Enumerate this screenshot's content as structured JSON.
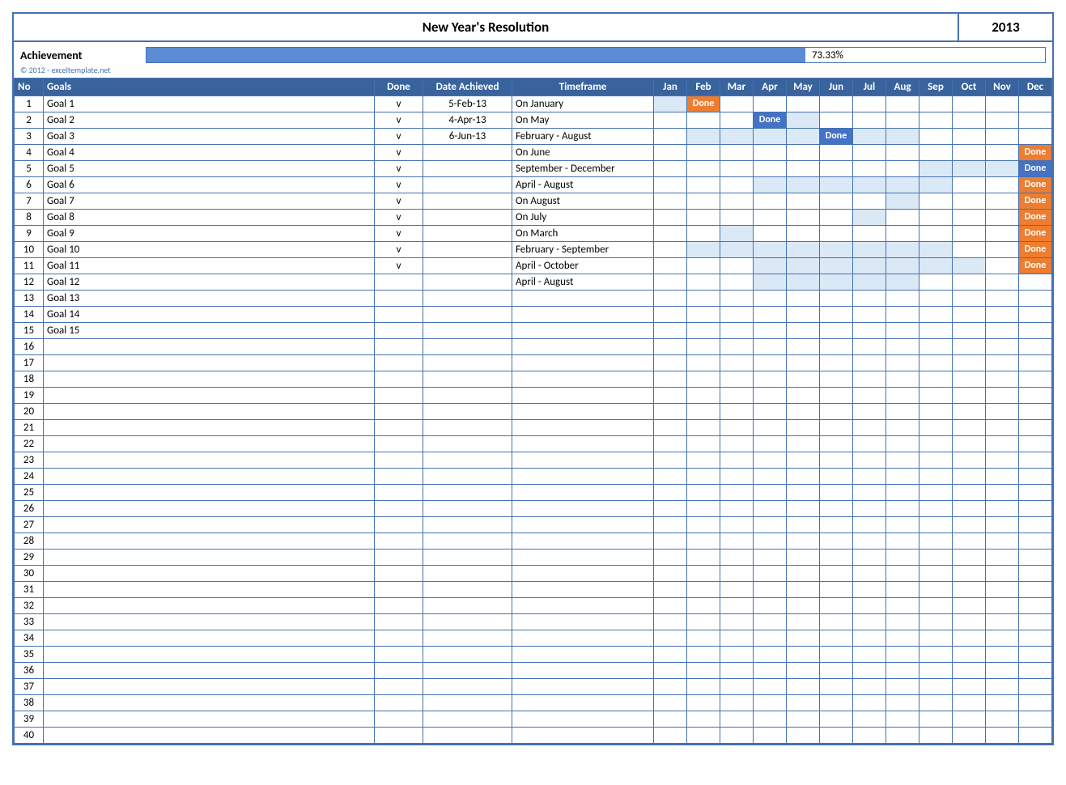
{
  "title": "New Year's Resolution",
  "year": "2013",
  "achievement_label": "Achievement",
  "achievement_percent": "73.33%",
  "achievement_fill": 73.33,
  "copyright": "© 2012 - exceltemplate.net",
  "months": [
    "Jan",
    "Feb",
    "Mar",
    "Apr",
    "May",
    "Jun",
    "Jul",
    "Aug",
    "Sep",
    "Oct",
    "Nov",
    "Dec"
  ],
  "headers": {
    "no": "No",
    "goals": "Goals",
    "done": "Done",
    "date": "Date Achieved",
    "timeframe": "Timeframe"
  },
  "done_label": "Done",
  "total_rows": 40,
  "rows": [
    {
      "no": 1,
      "goal": "Goal 1",
      "done": "v",
      "date": "5-Feb-13",
      "tf": "On January",
      "highlight": [
        0,
        1
      ],
      "badge": {
        "month": 1,
        "style": "orange"
      }
    },
    {
      "no": 2,
      "goal": "Goal 2",
      "done": "v",
      "date": "4-Apr-13",
      "tf": "On May",
      "highlight": [
        4
      ],
      "badge": {
        "month": 3,
        "style": "blue"
      }
    },
    {
      "no": 3,
      "goal": "Goal 3",
      "done": "v",
      "date": "6-Jun-13",
      "tf": "February - August",
      "highlight": [
        1,
        2,
        3,
        4,
        5,
        6,
        7
      ],
      "badge": {
        "month": 5,
        "style": "blue"
      }
    },
    {
      "no": 4,
      "goal": "Goal 4",
      "done": "v",
      "date": "",
      "tf": "On June",
      "highlight": [],
      "badge": {
        "month": 11,
        "style": "orange"
      }
    },
    {
      "no": 5,
      "goal": "Goal 5",
      "done": "v",
      "date": "",
      "tf": "September - December",
      "highlight": [
        8,
        9,
        10,
        11
      ],
      "badge": {
        "month": 11,
        "style": "blue"
      }
    },
    {
      "no": 6,
      "goal": "Goal 6",
      "done": "v",
      "date": "",
      "tf": "April - August",
      "highlight": [
        3,
        4,
        5,
        6,
        7,
        8
      ],
      "badge": {
        "month": 11,
        "style": "orange"
      }
    },
    {
      "no": 7,
      "goal": "Goal 7",
      "done": "v",
      "date": "",
      "tf": "On August",
      "highlight": [
        7
      ],
      "badge": {
        "month": 11,
        "style": "orange"
      }
    },
    {
      "no": 8,
      "goal": "Goal 8",
      "done": "v",
      "date": "",
      "tf": "On July",
      "highlight": [
        6
      ],
      "badge": {
        "month": 11,
        "style": "orange"
      }
    },
    {
      "no": 9,
      "goal": "Goal 9",
      "done": "v",
      "date": "",
      "tf": "On March",
      "highlight": [
        2
      ],
      "badge": {
        "month": 11,
        "style": "orange"
      }
    },
    {
      "no": 10,
      "goal": "Goal 10",
      "done": "v",
      "date": "",
      "tf": "February - September",
      "highlight": [
        1,
        2,
        3,
        4,
        5,
        6,
        7,
        8
      ],
      "badge": {
        "month": 11,
        "style": "orange"
      }
    },
    {
      "no": 11,
      "goal": "Goal 11",
      "done": "v",
      "date": "",
      "tf": "April - October",
      "highlight": [
        3,
        4,
        5,
        6,
        7,
        8,
        9
      ],
      "badge": {
        "month": 11,
        "style": "orange"
      }
    },
    {
      "no": 12,
      "goal": "Goal 12",
      "done": "",
      "date": "",
      "tf": "April - August",
      "highlight": [
        3,
        4,
        5,
        6,
        7
      ],
      "badge": null
    },
    {
      "no": 13,
      "goal": "Goal 13",
      "done": "",
      "date": "",
      "tf": "",
      "highlight": [],
      "badge": null
    },
    {
      "no": 14,
      "goal": "Goal 14",
      "done": "",
      "date": "",
      "tf": "",
      "highlight": [],
      "badge": null
    },
    {
      "no": 15,
      "goal": "Goal 15",
      "done": "",
      "date": "",
      "tf": "",
      "highlight": [],
      "badge": null
    }
  ]
}
